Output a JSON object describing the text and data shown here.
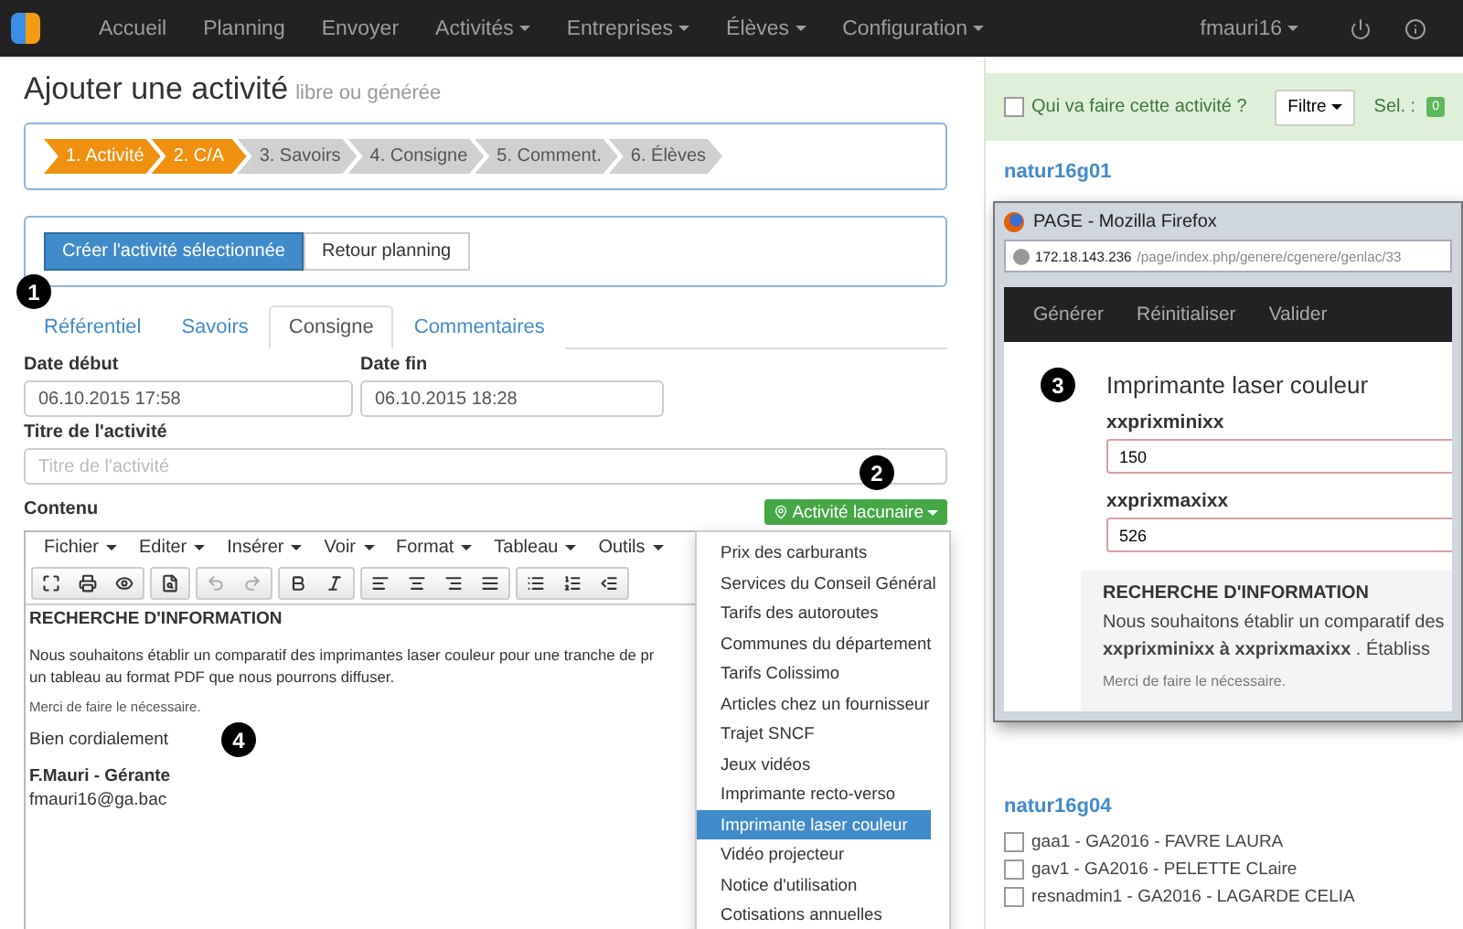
{
  "navbar": {
    "menu": [
      {
        "label": "Accueil",
        "dropdown": false
      },
      {
        "label": "Planning",
        "dropdown": false
      },
      {
        "label": "Envoyer",
        "dropdown": false
      },
      {
        "label": "Activités",
        "dropdown": true
      },
      {
        "label": "Entreprises",
        "dropdown": true
      },
      {
        "label": "Élèves",
        "dropdown": true
      },
      {
        "label": "Configuration",
        "dropdown": true
      }
    ],
    "user": "fmauri16"
  },
  "page": {
    "title": "Ajouter une activité",
    "subtitle": "libre ou générée"
  },
  "steps": [
    {
      "label": "1. Activité",
      "done": true
    },
    {
      "label": "2. C/A",
      "done": true
    },
    {
      "label": "3. Savoirs",
      "done": false
    },
    {
      "label": "4. Consigne",
      "done": false
    },
    {
      "label": "5. Comment.",
      "done": false
    },
    {
      "label": "6. Élèves",
      "done": false
    }
  ],
  "actions": [
    {
      "label": "Créer l'activité sélectionnée",
      "primary": true
    },
    {
      "label": "Retour planning",
      "primary": false
    }
  ],
  "tabs": [
    {
      "label": "Référentiel",
      "selected": false
    },
    {
      "label": "Savoirs",
      "selected": false
    },
    {
      "label": "Consigne",
      "selected": true
    },
    {
      "label": "Commentaires",
      "selected": false
    }
  ],
  "form": {
    "date_start": {
      "label": "Date début",
      "value": "06.10.2015 17:58"
    },
    "date_end": {
      "label": "Date fin",
      "value": "06.10.2015 18:28"
    },
    "title": {
      "label": "Titre de l'activité",
      "placeholder": "Titre de l'activité"
    },
    "content_label": "Contenu",
    "gap_button": "Activité lacunaire"
  },
  "editor": {
    "menus": [
      "Fichier",
      "Editer",
      "Insérer",
      "Voir",
      "Format",
      "Tableau",
      "Outils"
    ],
    "heading": "RECHERCHE D'INFORMATION",
    "paragraph_lines": [
      "Nous souhaitons établir un comparatif des imprimantes laser couleur pour une tranche de pr",
      "un tableau au format PDF que nous pourrons diffuser."
    ],
    "note": "Merci de faire le nécessaire.",
    "closing": "Bien cordialement",
    "signature": "F.Mauri - Gérante",
    "email": "fmauri16@ga.bac"
  },
  "gap_menu": [
    {
      "label": "Prix des carburants",
      "selected": false
    },
    {
      "label": "Services du Conseil Général",
      "selected": false
    },
    {
      "label": "Tarifs des autoroutes",
      "selected": false
    },
    {
      "label": "Communes du département",
      "selected": false
    },
    {
      "label": "Tarifs Colissimo",
      "selected": false
    },
    {
      "label": "Articles chez un fournisseur",
      "selected": false
    },
    {
      "label": "Trajet SNCF",
      "selected": false
    },
    {
      "label": "Jeux vidéos",
      "selected": false
    },
    {
      "label": "Imprimante recto-verso",
      "selected": false
    },
    {
      "label": "Imprimante laser couleur",
      "selected": true
    },
    {
      "label": "Vidéo projecteur",
      "selected": false
    },
    {
      "label": "Notice d'utilisation",
      "selected": false
    },
    {
      "label": "Cotisations annuelles",
      "selected": false
    }
  ],
  "sidebar": {
    "header": {
      "label": "Qui va faire cette activité ?",
      "checked": false,
      "filter": "Filtre",
      "sel_label": "Sel. :",
      "sel_count": "0"
    },
    "groups": [
      {
        "name": "natur16g01"
      },
      {
        "name": "natur16g04",
        "students": [
          {
            "label": "gaa1 - GA2016 - FAVRE LAURA",
            "checked": false
          },
          {
            "label": "gav1 - GA2016 - PELETTE CLaire",
            "checked": false
          },
          {
            "label": "resnadmin1 - GA2016 - LAGARDE CELIA",
            "checked": false
          }
        ]
      }
    ]
  },
  "popup": {
    "title": "PAGE - Mozilla Firefox",
    "url_host": "172.18.143.236",
    "url_path": "/page/index.php/genere/cgenere/genlac/33",
    "menu": [
      "Générer",
      "Réinitialiser",
      "Valider"
    ],
    "heading": "Imprimante laser couleur",
    "fields": [
      {
        "label": "xxprixminixx",
        "value": "150"
      },
      {
        "label": "xxprixmaxixx",
        "value": "526"
      }
    ],
    "preview": {
      "heading": "RECHERCHE D'INFORMATION",
      "lines": [
        "Nous souhaitons établir un comparatif des",
        "**xxprixminixx à xxprixmaxixx** . Établiss"
      ],
      "note": "Merci de faire le nécessaire."
    }
  },
  "callouts": [
    "1",
    "2",
    "3",
    "4"
  ]
}
